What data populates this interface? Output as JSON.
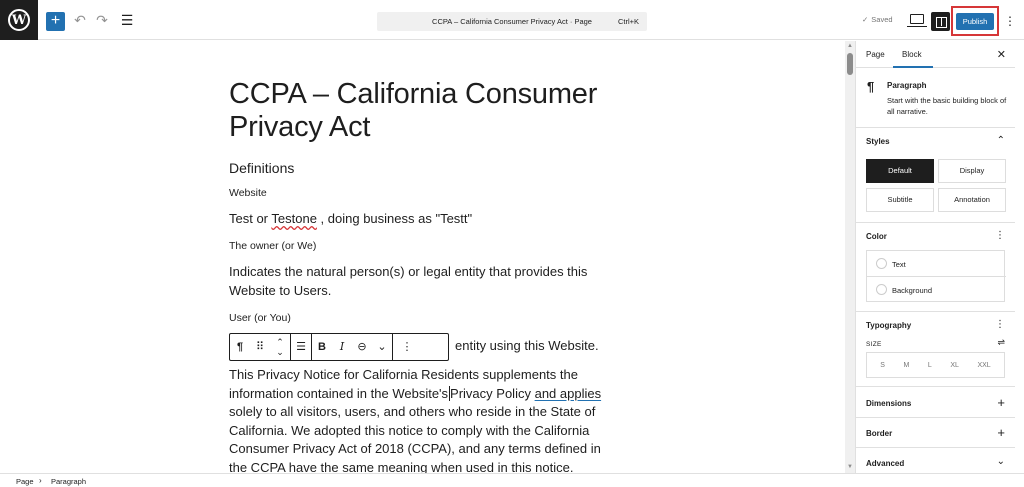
{
  "topbar": {
    "logo_letter": "W",
    "add_icon": "+",
    "undo_icon": "undo-icon",
    "redo_icon": "redo-icon",
    "list_view_icon": "list-view-icon",
    "document_title": "CCPA – California Consumer Privacy Act · Page",
    "shortcut": "Ctrl+K",
    "saved_label": "Saved",
    "publish_label": "Publish"
  },
  "content": {
    "title": "CCPA – California Consumer Privacy Act",
    "definitions_heading": "Definitions",
    "website_heading": "Website",
    "website_text_pre": "Test or ",
    "website_text_misspelled": "Testone",
    "website_text_post": " , doing business as \"Testt\"",
    "owner_heading": "The owner (or We)",
    "owner_text": "Indicates the natural person(s) or legal entity that provides this Website to Users.",
    "user_heading": "User (or You)",
    "user_text_tail": "entity using this Website.",
    "notice_pre": "This Privacy Notice for California Residents supplements the information contained in the Website's",
    "notice_link": "Privacy Policy",
    "notice_link2": "and applies",
    "notice_post": "solely to all visitors, users, and others who reside in the State of California. We adopted this notice to comply with the California Consumer Privacy Act of 2018 (CCPA), and any terms defined in the CCPA have the same meaning when used in this notice."
  },
  "block_toolbar": {
    "paragraph_icon": "¶",
    "drag_icon": "⠿",
    "move_icon": "⌃",
    "align_icon": "align-icon",
    "bold": "B",
    "italic": "I",
    "link_icon": "link-icon",
    "more_icon": "chevron-down-icon",
    "options_icon": "⋮"
  },
  "sidebar": {
    "tab_page": "Page",
    "tab_block": "Block",
    "block_name": "Paragraph",
    "block_desc": "Start with the basic building block of all narrative.",
    "styles_heading": "Styles",
    "styles": [
      "Default",
      "Display",
      "Subtitle",
      "Annotation"
    ],
    "active_style": "Default",
    "color_heading": "Color",
    "color_items": [
      "Text",
      "Background"
    ],
    "typography_heading": "Typography",
    "size_label": "SIZE",
    "sizes": [
      "S",
      "M",
      "L",
      "XL",
      "XXL"
    ],
    "dimensions_heading": "Dimensions",
    "border_heading": "Border",
    "advanced_heading": "Advanced"
  },
  "footer": {
    "crumbs": [
      "Page",
      "Paragraph"
    ]
  },
  "colors": {
    "accent": "#2271b1",
    "highlight_border": "#d63638",
    "dark": "#1e1e1e"
  }
}
